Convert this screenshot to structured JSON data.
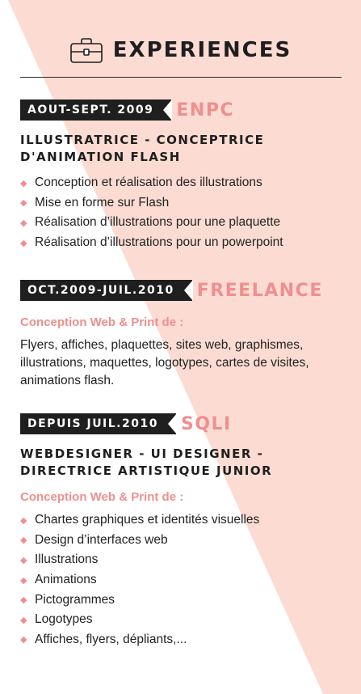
{
  "header": {
    "title": "EXPERIENCES",
    "icon": "briefcase-icon"
  },
  "colors": {
    "accent": "#ef8f8f",
    "background_shape": "#fcdcd2",
    "tag_bg": "#1f1f1f",
    "text": "#222222"
  },
  "experiences": [
    {
      "date": "AOUT-SEPT. 2009",
      "company": "ENPC",
      "role": [
        "ILLUSTRATRICE - CONCEPTRICE",
        "D'ANIMATION FLASH"
      ],
      "items": [
        "Conception et réalisation des illustrations",
        "Mise en forme sur Flash",
        "Réalisation d’illustrations pour une plaquette",
        "Réalisation d’illustrations pour un powerpoint"
      ]
    },
    {
      "date": "OCT.2009-JUIL.2010",
      "company": "FREELANCE",
      "subheading": "Conception Web & Print de :",
      "paragraph": "Flyers, affiches, plaquettes, sites web, graphismes, illustrations, maquettes, logotypes, cartes de visites, animations flash."
    },
    {
      "date": "DEPUIS JUIL.2010",
      "company": "SQLI",
      "role": [
        "WEBDESIGNER - UI DESIGNER -",
        "DIRECTRICE ARTISTIQUE JUNIOR"
      ],
      "subheading": "Conception Web & Print de :",
      "items": [
        "Chartes graphiques et identités visuelles",
        "Design d’interfaces web",
        "Illustrations",
        "Animations",
        "Pictogrammes",
        "Logotypes",
        "Affiches, flyers, dépliants,..."
      ]
    }
  ]
}
